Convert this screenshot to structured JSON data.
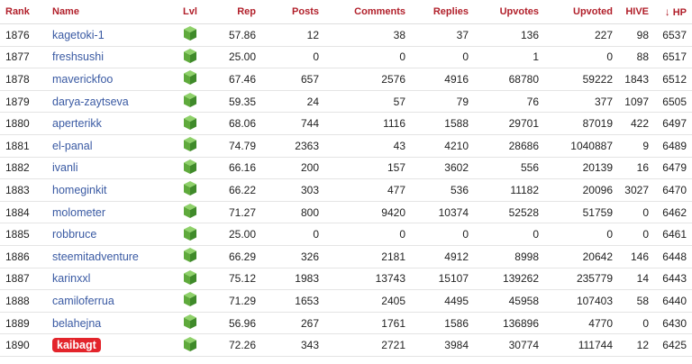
{
  "columns": {
    "rank": "Rank",
    "name": "Name",
    "lvl": "Lvl",
    "rep": "Rep",
    "posts": "Posts",
    "comments": "Comments",
    "replies": "Replies",
    "upvotes": "Upvotes",
    "upvoted": "Upvoted",
    "hive": "HIVE",
    "hp": "HP"
  },
  "sort": {
    "column": "hp",
    "direction": "desc",
    "icon": "arrow-down-icon"
  },
  "colors": {
    "header": "#b11f2a",
    "link": "#3a5aa3",
    "highlight": "#e3242b",
    "level_icon": "#5faa3c"
  },
  "level_icon": "green-cube-icon",
  "rows": [
    {
      "rank": "1876",
      "name": "kagetoki-1",
      "rep": "57.86",
      "posts": "12",
      "comments": "38",
      "replies": "37",
      "upvotes": "136",
      "upvoted": "227",
      "hive": "98",
      "hp": "6537"
    },
    {
      "rank": "1877",
      "name": "freshsushi",
      "rep": "25.00",
      "posts": "0",
      "comments": "0",
      "replies": "0",
      "upvotes": "1",
      "upvoted": "0",
      "hive": "88",
      "hp": "6517"
    },
    {
      "rank": "1878",
      "name": "maverickfoo",
      "rep": "67.46",
      "posts": "657",
      "comments": "2576",
      "replies": "4916",
      "upvotes": "68780",
      "upvoted": "59222",
      "hive": "1843",
      "hp": "6512"
    },
    {
      "rank": "1879",
      "name": "darya-zaytseva",
      "rep": "59.35",
      "posts": "24",
      "comments": "57",
      "replies": "79",
      "upvotes": "76",
      "upvoted": "377",
      "hive": "1097",
      "hp": "6505"
    },
    {
      "rank": "1880",
      "name": "aperterikk",
      "rep": "68.06",
      "posts": "744",
      "comments": "1116",
      "replies": "1588",
      "upvotes": "29701",
      "upvoted": "87019",
      "hive": "422",
      "hp": "6497"
    },
    {
      "rank": "1881",
      "name": "el-panal",
      "rep": "74.79",
      "posts": "2363",
      "comments": "43",
      "replies": "4210",
      "upvotes": "28686",
      "upvoted": "1040887",
      "hive": "9",
      "hp": "6489"
    },
    {
      "rank": "1882",
      "name": "ivanli",
      "rep": "66.16",
      "posts": "200",
      "comments": "157",
      "replies": "3602",
      "upvotes": "556",
      "upvoted": "20139",
      "hive": "16",
      "hp": "6479"
    },
    {
      "rank": "1883",
      "name": "homeginkit",
      "rep": "66.22",
      "posts": "303",
      "comments": "477",
      "replies": "536",
      "upvotes": "11182",
      "upvoted": "20096",
      "hive": "3027",
      "hp": "6470"
    },
    {
      "rank": "1884",
      "name": "molometer",
      "rep": "71.27",
      "posts": "800",
      "comments": "9420",
      "replies": "10374",
      "upvotes": "52528",
      "upvoted": "51759",
      "hive": "0",
      "hp": "6462"
    },
    {
      "rank": "1885",
      "name": "robbruce",
      "rep": "25.00",
      "posts": "0",
      "comments": "0",
      "replies": "0",
      "upvotes": "0",
      "upvoted": "0",
      "hive": "0",
      "hp": "6461"
    },
    {
      "rank": "1886",
      "name": "steemitadventure",
      "rep": "66.29",
      "posts": "326",
      "comments": "2181",
      "replies": "4912",
      "upvotes": "8998",
      "upvoted": "20642",
      "hive": "146",
      "hp": "6448"
    },
    {
      "rank": "1887",
      "name": "karinxxl",
      "rep": "75.12",
      "posts": "1983",
      "comments": "13743",
      "replies": "15107",
      "upvotes": "139262",
      "upvoted": "235779",
      "hive": "14",
      "hp": "6443"
    },
    {
      "rank": "1888",
      "name": "camiloferrua",
      "rep": "71.29",
      "posts": "1653",
      "comments": "2405",
      "replies": "4495",
      "upvotes": "45958",
      "upvoted": "107403",
      "hive": "58",
      "hp": "6440"
    },
    {
      "rank": "1889",
      "name": "belahejna",
      "rep": "56.96",
      "posts": "267",
      "comments": "1761",
      "replies": "1586",
      "upvotes": "136896",
      "upvoted": "4770",
      "hive": "0",
      "hp": "6430"
    },
    {
      "rank": "1890",
      "name": "kaibagt",
      "rep": "72.26",
      "posts": "343",
      "comments": "2721",
      "replies": "3984",
      "upvotes": "30774",
      "upvoted": "111744",
      "hive": "12",
      "hp": "6425",
      "highlight": true
    }
  ]
}
